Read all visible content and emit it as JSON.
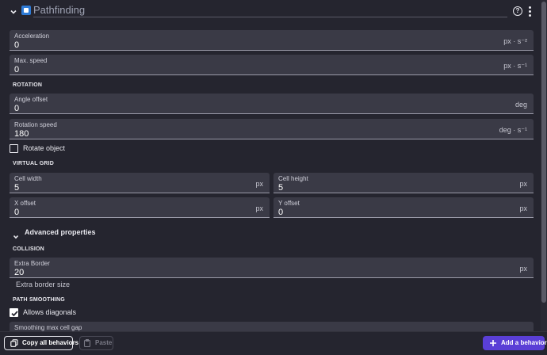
{
  "header": {
    "title": "Pathfinding",
    "help_icon_glyph": "?"
  },
  "fields": {
    "acceleration": {
      "label": "Acceleration",
      "value": "0",
      "unit": "px · s⁻²"
    },
    "max_speed": {
      "label": "Max. speed",
      "value": "0",
      "unit": "px · s⁻¹"
    },
    "angle_offset": {
      "label": "Angle offset",
      "value": "0",
      "unit": "deg"
    },
    "rotation_speed": {
      "label": "Rotation speed",
      "value": "180",
      "unit": "deg · s⁻¹"
    },
    "cell_width": {
      "label": "Cell width",
      "value": "5",
      "unit": "px"
    },
    "cell_height": {
      "label": "Cell height",
      "value": "5",
      "unit": "px"
    },
    "x_offset": {
      "label": "X offset",
      "value": "0",
      "unit": "px"
    },
    "y_offset": {
      "label": "Y offset",
      "value": "0",
      "unit": "px"
    },
    "extra_border": {
      "label": "Extra Border",
      "value": "20",
      "unit": "px",
      "helper": "Extra border size"
    },
    "smoothing_max_cell_gap": {
      "label": "Smoothing max cell gap"
    }
  },
  "sections": {
    "rotation": "ROTATION",
    "virtual_grid": "VIRTUAL GRID",
    "collision": "COLLISION",
    "path_smoothing": "PATH SMOOTHING"
  },
  "checkboxes": {
    "rotate_object": {
      "label": "Rotate object",
      "checked": false
    },
    "allows_diagonals": {
      "label": "Allows diagonals",
      "checked": true
    }
  },
  "advanced": {
    "label": "Advanced properties"
  },
  "bottom_bar": {
    "copy_label": "Copy all behaviors",
    "paste_label": "Paste",
    "add_label": "Add a behavior"
  },
  "colors": {
    "background": "#25252f",
    "field_bg": "#3a3a46",
    "accent": "#5a3fd6",
    "behavior_icon": "#2e7bd6"
  }
}
